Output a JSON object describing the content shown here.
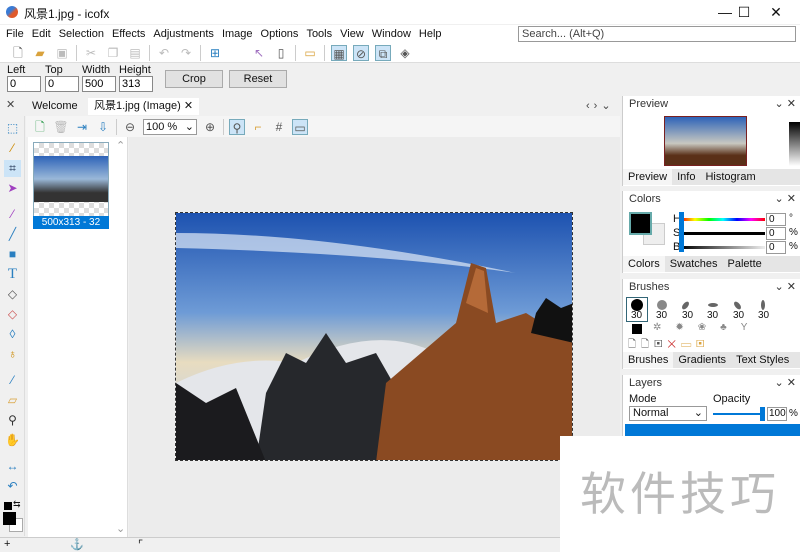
{
  "window": {
    "title": "风景1.jpg - icofx",
    "minimize": "—",
    "maximize": "☐",
    "close": "✕"
  },
  "menu": [
    "File",
    "Edit",
    "Selection",
    "Effects",
    "Adjustments",
    "Image",
    "Options",
    "Tools",
    "View",
    "Window",
    "Help"
  ],
  "search": {
    "placeholder": "Search... (Alt+Q)"
  },
  "crop": {
    "left_label": "Left",
    "left": "0",
    "top_label": "Top",
    "top": "0",
    "width_label": "Width",
    "width": "500",
    "height_label": "Height",
    "height": "313",
    "crop_btn": "Crop",
    "reset_btn": "Reset"
  },
  "tabs": [
    {
      "label": "Welcome"
    },
    {
      "label": "风景1.jpg (Image)"
    }
  ],
  "doc": {
    "zoom": "100 %"
  },
  "thumb": {
    "caption": "500x313 - 32"
  },
  "panels": {
    "preview": {
      "title": "Preview",
      "tabs": [
        "Preview",
        "Info",
        "Histogram"
      ]
    },
    "colors": {
      "title": "Colors",
      "h_label": "H",
      "s_label": "S",
      "b_label": "B",
      "h": "0",
      "s": "0",
      "b": "0",
      "h_unit": "°",
      "s_unit": "%",
      "b_unit": "%",
      "tabs": [
        "Colors",
        "Swatches",
        "Palette"
      ]
    },
    "brushes": {
      "title": "Brushes",
      "sizes": [
        "30",
        "30",
        "30",
        "30",
        "30",
        "30"
      ],
      "tabs": [
        "Brushes",
        "Gradients",
        "Text Styles"
      ]
    },
    "layers": {
      "title": "Layers",
      "mode_label": "Mode",
      "mode": "Normal",
      "opacity_label": "Opacity",
      "opacity": "100",
      "opacity_unit": "%"
    }
  },
  "watermark": "软件技巧",
  "colors": {
    "accent": "#0078d7",
    "selection": "#cce4f7"
  }
}
